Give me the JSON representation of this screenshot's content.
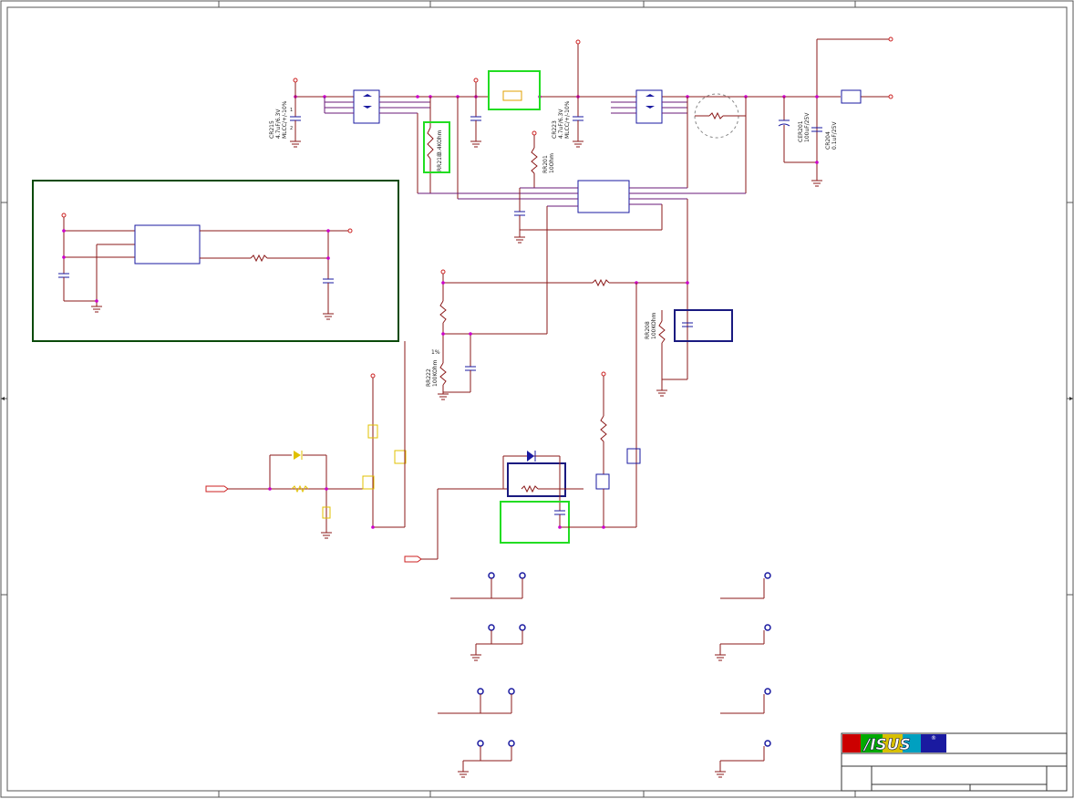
{
  "schematic": {
    "components": [
      {
        "ref": "CR215",
        "line1": "4.7uF/6.3V",
        "line2": "MLCC/+/-10%"
      },
      {
        "ref": "CR223",
        "line1": "4.7uF/6.3V",
        "line2": "MLCC/+/-10%"
      },
      {
        "ref": "RR218",
        "value": "3.4KOhm"
      },
      {
        "ref": "RR201",
        "value": "10Ohm"
      },
      {
        "ref": "CER201",
        "value": "100uF/25V"
      },
      {
        "ref": "CR204",
        "value": "0.1uF/25V"
      },
      {
        "ref": "RR222",
        "value": "100KOhm",
        "tolerance": "1%"
      },
      {
        "ref": "RR208",
        "value": "100KOhm"
      }
    ]
  },
  "title_block": {
    "logo_text": "/ISUS",
    "logo_mark": "®"
  },
  "colors": {
    "wire": "#8b1a1a",
    "bus": "#6a1a7a",
    "highlight_green": "#22dd22",
    "highlight_blue": "#1a1a80",
    "group_box": "#0a4a0a",
    "junction": "#cc00cc"
  }
}
